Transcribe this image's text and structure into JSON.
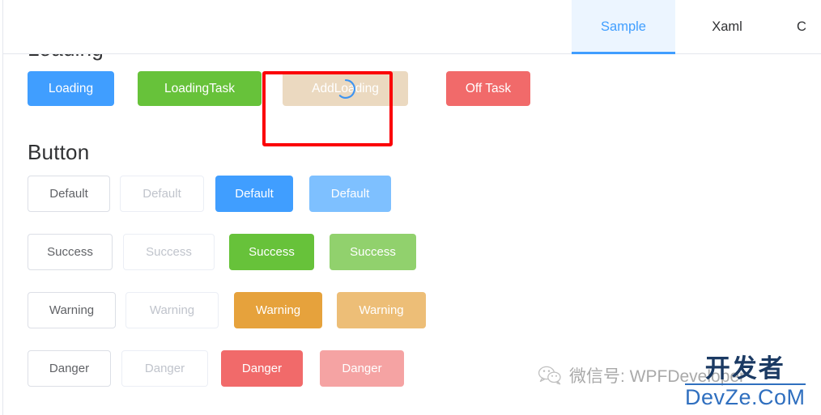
{
  "window": {
    "background": "#ffffff",
    "accent": "#409eff"
  },
  "tabs": {
    "items": [
      {
        "label": "Sample",
        "active": true
      },
      {
        "label": "Xaml",
        "active": false
      },
      {
        "label": "C",
        "active": false,
        "clipped": true
      }
    ]
  },
  "content": {
    "clipped_heading": "Loading",
    "loading_row": {
      "buttons": [
        {
          "label": "Loading",
          "color": "#409eff",
          "text_color": "#ffffff"
        },
        {
          "label": "LoadingTask",
          "color": "#67c23a",
          "text_color": "#ffffff"
        },
        {
          "label": "AddLoading",
          "color": "#ebd9c0",
          "text_color": "#ffffff",
          "spinner": true,
          "spinner_color": "#409eff",
          "annotated": true
        },
        {
          "label": "Off Task",
          "color": "#f16a6a",
          "text_color": "#ffffff"
        }
      ]
    },
    "annotation": {
      "name": "red-highlight-box",
      "color": "#fb0007"
    },
    "section_title": "Button",
    "button_matrix": {
      "variants": [
        "plain",
        "ghost",
        "solid",
        "light"
      ],
      "rows": [
        {
          "name": "default",
          "label": "Default",
          "solid_color": "#409eff",
          "light_color": "#7ec0ff",
          "widths": [
            102,
            104,
            96,
            101
          ]
        },
        {
          "name": "success",
          "label": "Success",
          "solid_color": "#67c23a",
          "light_color": "#91d16d",
          "widths": [
            105,
            113,
            105,
            107
          ]
        },
        {
          "name": "warning",
          "label": "Warning",
          "solid_color": "#e6a23c",
          "light_color": "#edbe77",
          "widths": [
            109,
            115,
            109,
            110
          ]
        },
        {
          "name": "danger",
          "label": "Danger",
          "solid_color": "#f16a6a",
          "light_color": "#f5a3a3",
          "widths": [
            103,
            107,
            101,
            104
          ]
        }
      ]
    }
  },
  "watermarks": {
    "wechat": {
      "icon": "wechat-icon",
      "text": "微信号: WPFDeveloper",
      "color": "#9b9b9b"
    },
    "devze": {
      "cn": "开发者",
      "en": "DevZe.CoM",
      "cn_color": "#1b3a63",
      "en_color": "#2f6fbf"
    }
  }
}
